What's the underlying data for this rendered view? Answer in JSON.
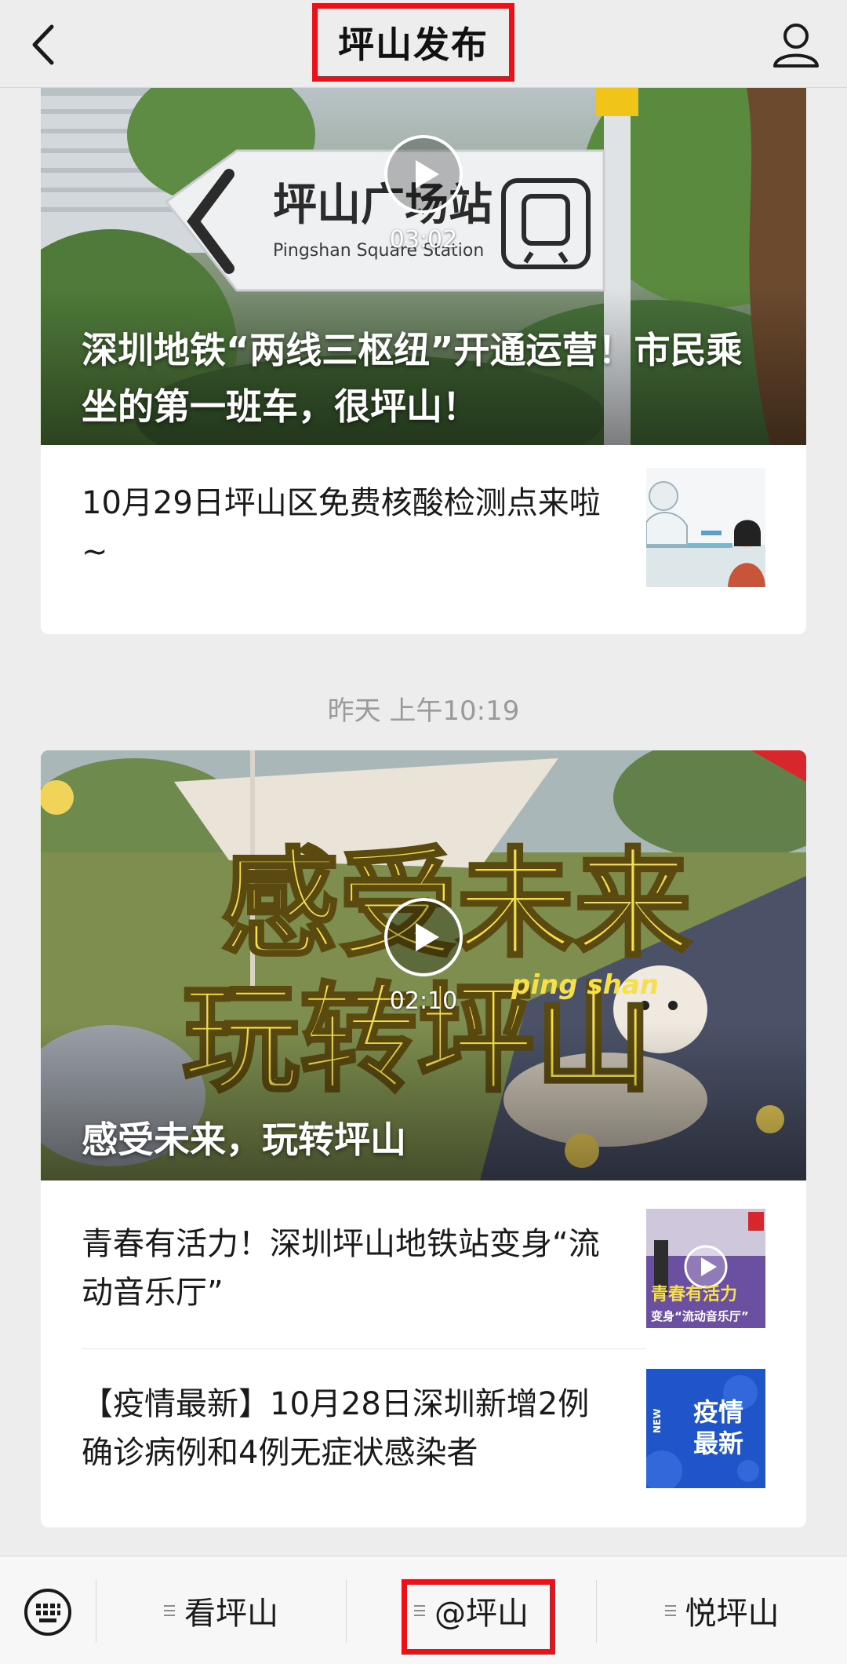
{
  "header": {
    "title": "坪山发布"
  },
  "articles_group_1": {
    "hero": {
      "duration": "03:02",
      "title": "深圳地铁“两线三枢纽”开通运营！市民乘坐的第一班车，很坪山！",
      "image_text": {
        "station_cn": "坪山广场站",
        "station_en": "Pingshan Square Station"
      }
    },
    "items": [
      {
        "title": "10月29日坪山区免费核酸检测点来啦~"
      }
    ]
  },
  "timestamp": "昨天 上午10:19",
  "articles_group_2": {
    "hero": {
      "duration": "02:10",
      "title": "感受未来，玩转坪山",
      "image_text": {
        "line1": "感受未来",
        "line2": "玩转坪山",
        "pinyin": "ping shan"
      }
    },
    "items": [
      {
        "title": "青春有活力！深圳坪山地铁站变身“流动音乐厅”",
        "thumb_text": {
          "line1": "青春有活力",
          "line2": "变身“流动音乐厅”"
        }
      },
      {
        "title": "【疫情最新】10月28日深圳新增2例确诊病例和4例无症状感染者",
        "thumb_text": {
          "line1": "疫情",
          "line2": "最新",
          "badge": "NEW"
        }
      }
    ]
  },
  "bottom_menu": {
    "items": [
      {
        "label": "看坪山"
      },
      {
        "label": "@坪山"
      },
      {
        "label": "悦坪山"
      }
    ]
  },
  "colors": {
    "highlight": "#e8131a",
    "background": "#ededed"
  }
}
